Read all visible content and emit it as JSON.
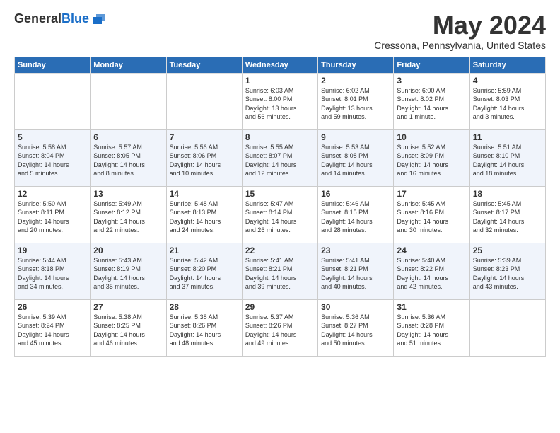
{
  "header": {
    "logo_general": "General",
    "logo_blue": "Blue",
    "month": "May 2024",
    "location": "Cressona, Pennsylvania, United States"
  },
  "weekdays": [
    "Sunday",
    "Monday",
    "Tuesday",
    "Wednesday",
    "Thursday",
    "Friday",
    "Saturday"
  ],
  "weeks": [
    [
      {
        "day": "",
        "info": ""
      },
      {
        "day": "",
        "info": ""
      },
      {
        "day": "",
        "info": ""
      },
      {
        "day": "1",
        "info": "Sunrise: 6:03 AM\nSunset: 8:00 PM\nDaylight: 13 hours\nand 56 minutes."
      },
      {
        "day": "2",
        "info": "Sunrise: 6:02 AM\nSunset: 8:01 PM\nDaylight: 13 hours\nand 59 minutes."
      },
      {
        "day": "3",
        "info": "Sunrise: 6:00 AM\nSunset: 8:02 PM\nDaylight: 14 hours\nand 1 minute."
      },
      {
        "day": "4",
        "info": "Sunrise: 5:59 AM\nSunset: 8:03 PM\nDaylight: 14 hours\nand 3 minutes."
      }
    ],
    [
      {
        "day": "5",
        "info": "Sunrise: 5:58 AM\nSunset: 8:04 PM\nDaylight: 14 hours\nand 5 minutes."
      },
      {
        "day": "6",
        "info": "Sunrise: 5:57 AM\nSunset: 8:05 PM\nDaylight: 14 hours\nand 8 minutes."
      },
      {
        "day": "7",
        "info": "Sunrise: 5:56 AM\nSunset: 8:06 PM\nDaylight: 14 hours\nand 10 minutes."
      },
      {
        "day": "8",
        "info": "Sunrise: 5:55 AM\nSunset: 8:07 PM\nDaylight: 14 hours\nand 12 minutes."
      },
      {
        "day": "9",
        "info": "Sunrise: 5:53 AM\nSunset: 8:08 PM\nDaylight: 14 hours\nand 14 minutes."
      },
      {
        "day": "10",
        "info": "Sunrise: 5:52 AM\nSunset: 8:09 PM\nDaylight: 14 hours\nand 16 minutes."
      },
      {
        "day": "11",
        "info": "Sunrise: 5:51 AM\nSunset: 8:10 PM\nDaylight: 14 hours\nand 18 minutes."
      }
    ],
    [
      {
        "day": "12",
        "info": "Sunrise: 5:50 AM\nSunset: 8:11 PM\nDaylight: 14 hours\nand 20 minutes."
      },
      {
        "day": "13",
        "info": "Sunrise: 5:49 AM\nSunset: 8:12 PM\nDaylight: 14 hours\nand 22 minutes."
      },
      {
        "day": "14",
        "info": "Sunrise: 5:48 AM\nSunset: 8:13 PM\nDaylight: 14 hours\nand 24 minutes."
      },
      {
        "day": "15",
        "info": "Sunrise: 5:47 AM\nSunset: 8:14 PM\nDaylight: 14 hours\nand 26 minutes."
      },
      {
        "day": "16",
        "info": "Sunrise: 5:46 AM\nSunset: 8:15 PM\nDaylight: 14 hours\nand 28 minutes."
      },
      {
        "day": "17",
        "info": "Sunrise: 5:45 AM\nSunset: 8:16 PM\nDaylight: 14 hours\nand 30 minutes."
      },
      {
        "day": "18",
        "info": "Sunrise: 5:45 AM\nSunset: 8:17 PM\nDaylight: 14 hours\nand 32 minutes."
      }
    ],
    [
      {
        "day": "19",
        "info": "Sunrise: 5:44 AM\nSunset: 8:18 PM\nDaylight: 14 hours\nand 34 minutes."
      },
      {
        "day": "20",
        "info": "Sunrise: 5:43 AM\nSunset: 8:19 PM\nDaylight: 14 hours\nand 35 minutes."
      },
      {
        "day": "21",
        "info": "Sunrise: 5:42 AM\nSunset: 8:20 PM\nDaylight: 14 hours\nand 37 minutes."
      },
      {
        "day": "22",
        "info": "Sunrise: 5:41 AM\nSunset: 8:21 PM\nDaylight: 14 hours\nand 39 minutes."
      },
      {
        "day": "23",
        "info": "Sunrise: 5:41 AM\nSunset: 8:21 PM\nDaylight: 14 hours\nand 40 minutes."
      },
      {
        "day": "24",
        "info": "Sunrise: 5:40 AM\nSunset: 8:22 PM\nDaylight: 14 hours\nand 42 minutes."
      },
      {
        "day": "25",
        "info": "Sunrise: 5:39 AM\nSunset: 8:23 PM\nDaylight: 14 hours\nand 43 minutes."
      }
    ],
    [
      {
        "day": "26",
        "info": "Sunrise: 5:39 AM\nSunset: 8:24 PM\nDaylight: 14 hours\nand 45 minutes."
      },
      {
        "day": "27",
        "info": "Sunrise: 5:38 AM\nSunset: 8:25 PM\nDaylight: 14 hours\nand 46 minutes."
      },
      {
        "day": "28",
        "info": "Sunrise: 5:38 AM\nSunset: 8:26 PM\nDaylight: 14 hours\nand 48 minutes."
      },
      {
        "day": "29",
        "info": "Sunrise: 5:37 AM\nSunset: 8:26 PM\nDaylight: 14 hours\nand 49 minutes."
      },
      {
        "day": "30",
        "info": "Sunrise: 5:36 AM\nSunset: 8:27 PM\nDaylight: 14 hours\nand 50 minutes."
      },
      {
        "day": "31",
        "info": "Sunrise: 5:36 AM\nSunset: 8:28 PM\nDaylight: 14 hours\nand 51 minutes."
      },
      {
        "day": "",
        "info": ""
      }
    ]
  ]
}
